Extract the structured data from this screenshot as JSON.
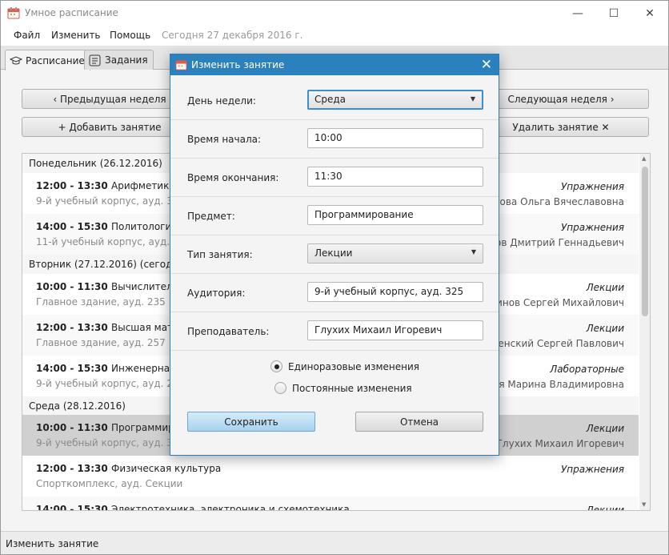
{
  "window": {
    "title": "Умное расписание",
    "minimize_icon": "—",
    "maximize_icon": "☐",
    "close_icon": "✕"
  },
  "menu": {
    "file": "Файл",
    "edit": "Изменить",
    "help": "Помощь",
    "today": "Сегодня 27 декабря 2016 г."
  },
  "tabs": [
    {
      "label": "Расписание"
    },
    {
      "label": "Задания"
    }
  ],
  "toolbar": {
    "prev_week": "‹  Предыдущая неделя",
    "next_week": "Следующая неделя  ›",
    "add_lesson": "+ Добавить занятие",
    "delete_lesson": "Удалить занятие ✕"
  },
  "days": [
    {
      "header": "Понедельник (26.12.2016)"
    },
    {
      "header": "Вторник (27.12.2016) (сегодня)"
    },
    {
      "header": "Среда (28.12.2016)"
    }
  ],
  "lessons": [
    {
      "time": "12:00 - 13:30",
      "subject": "Арифметика",
      "room": "9-й учебный корпус, ауд. 319",
      "type": "Упражнения",
      "teacher": "Мустафутова Ольга Вячеславовна"
    },
    {
      "time": "14:00 - 15:30",
      "subject": "Политология",
      "room": "11-й учебный корпус, ауд. 309",
      "type": "Упражнения",
      "teacher": "Прокопов Дмитрий Геннадьевич"
    },
    {
      "time": "10:00 - 11:30",
      "subject": "Вычислительная математика",
      "room": "Главное здание, ауд. 235",
      "type": "Лекции",
      "teacher": "Устинов Сергей Михайлович"
    },
    {
      "time": "12:00 - 13:30",
      "subject": "Высшая математика",
      "room": "Главное здание, ауд. 257",
      "type": "Лекции",
      "teacher": "Баженский Сергей Павлович"
    },
    {
      "time": "14:00 - 15:30",
      "subject": "Инженерная графика",
      "room": "9-й учебный корпус, ауд. 215",
      "type": "Лабораторные",
      "teacher": "Московская Марина Владимировна"
    },
    {
      "time": "10:00 - 11:30",
      "subject": "Программирование",
      "room": "9-й учебный корпус, ауд. 325",
      "type": "Лекции",
      "teacher": "Глухих Михаил Игоревич"
    },
    {
      "time": "12:00 - 13:30",
      "subject": "Физическая культура",
      "room": "Спорткомплекс, ауд. Секции",
      "type": "Упражнения",
      "teacher": ""
    },
    {
      "time": "14:00 - 15:30",
      "subject": "Электротехника, электроника и схемотехника",
      "room": "",
      "type": "Лекции",
      "teacher": ""
    }
  ],
  "status": {
    "text": "Изменить занятие"
  },
  "dialog": {
    "title": "Изменить занятие",
    "close_icon": "✕",
    "fields": {
      "day_label": "День недели:",
      "day_value": "Среда",
      "start_label": "Время начала:",
      "start_value": "10:00",
      "end_label": "Время окончания:",
      "end_value": "11:30",
      "subject_label": "Предмет:",
      "subject_value": "Программирование",
      "type_label": "Тип занятия:",
      "type_value": "Лекции",
      "room_label": "Аудитория:",
      "room_value": "9-й учебный корпус, ауд. 325",
      "teacher_label": "Преподаватель:",
      "teacher_value": "Глухих Михаил Игоревич"
    },
    "radio_once": "Единоразовые изменения",
    "radio_permanent": "Постоянные изменения",
    "save": "Сохранить",
    "cancel": "Отмена"
  },
  "icons": {
    "calendar": "calendar-icon",
    "graduation": "graduation-cap-icon",
    "tasks": "tasks-icon",
    "dropdown": "chevron-down-icon"
  },
  "colors": {
    "dialog_title_bg": "#2b80be",
    "selected_row": "#d0d0d0",
    "save_button": "#a8d2ee"
  }
}
